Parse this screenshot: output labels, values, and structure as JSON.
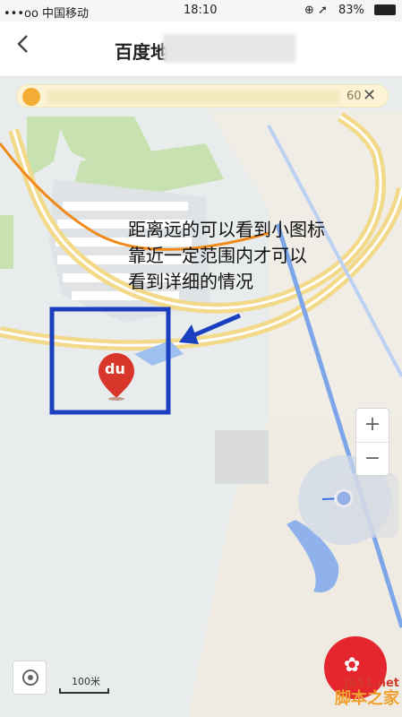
{
  "status_bar": {
    "carrier": "•••oo 中国移动",
    "time": "18:10",
    "battery": "83%"
  },
  "nav": {
    "back_icon": "chevron-left-icon",
    "title": "百度地"
  },
  "tip": {
    "text_tail": "60",
    "close": "✕"
  },
  "annotation": {
    "lines": [
      "距离远的可以看到小图标",
      "靠近一定范围内才可以",
      "看到详细的情况"
    ]
  },
  "map": {
    "poi_label": "du"
  },
  "zoom": {
    "in": "+",
    "out": "−"
  },
  "scale": {
    "label": "100米"
  },
  "watermark": {
    "url": "jb51.net",
    "name": "脚本之家"
  },
  "colors": {
    "highlight_box": "#1a3fbf",
    "route": "#f08a1a",
    "poi": "#d9362b",
    "gift": "#e5262e"
  }
}
